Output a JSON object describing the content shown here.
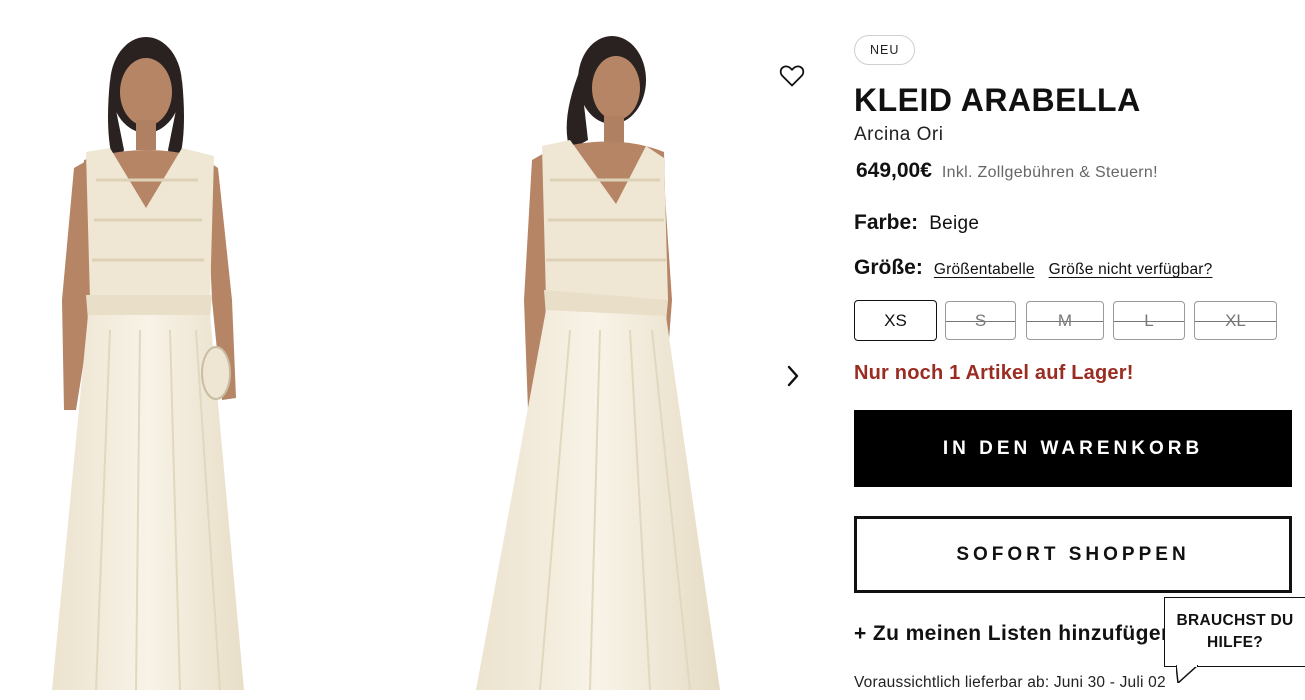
{
  "gallery": {
    "images": [
      {
        "alt": "front-view",
        "icon": "model-photo"
      },
      {
        "alt": "side-view",
        "icon": "model-photo"
      }
    ],
    "wishlist_icon": "heart-outline-icon",
    "next_icon": "chevron-right-icon"
  },
  "product": {
    "badge": "NEU",
    "title": "KLEID ARABELLA",
    "brand": "Arcina Ori",
    "price": "649,00€",
    "price_note": "Inkl. Zollgebühren & Steuern!",
    "color_label": "Farbe:",
    "color_value": "Beige",
    "size_label": "Größe:",
    "size_chart_link": "Größentabelle",
    "size_unavailable_link": "Größe nicht verfügbar?",
    "sizes": [
      {
        "label": "XS",
        "available": true,
        "selected": true
      },
      {
        "label": "S",
        "available": false,
        "selected": false
      },
      {
        "label": "M",
        "available": false,
        "selected": false
      },
      {
        "label": "L",
        "available": false,
        "selected": false
      },
      {
        "label": "XL",
        "available": false,
        "selected": false
      }
    ],
    "stock_message": "Nur noch 1 Artikel auf Lager!",
    "add_to_cart": "IN DEN WARENKORB",
    "buy_now": "SOFORT SHOPPEN",
    "add_to_list": "+ Zu meinen Listen hinzufügen",
    "delivery": "Voraussichtlich lieferbar ab: Juni 30 - Juli 02"
  },
  "help_widget": {
    "label": "BRAUCHST DU HILFE?"
  },
  "colors": {
    "accent_stock": "#9b2c22",
    "button_primary_bg": "#000000",
    "dress": "#f3ecdd"
  }
}
